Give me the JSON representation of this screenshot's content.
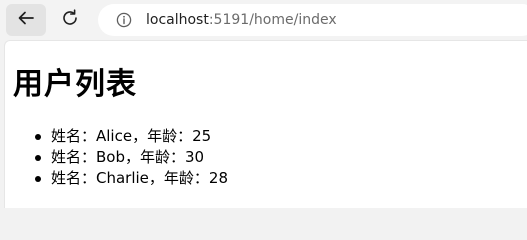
{
  "browser": {
    "url_host": "localhost",
    "url_path": ":5191/home/index"
  },
  "page": {
    "title": "用户列表",
    "users": [
      {
        "text": "姓名：Alice，年龄：25"
      },
      {
        "text": "姓名：Bob，年龄：30"
      },
      {
        "text": "姓名：Charlie，年龄：28"
      }
    ]
  },
  "icons": {
    "back": "arrow-left-icon",
    "reload": "reload-icon",
    "info": "info-icon"
  },
  "colors": {
    "toolbar_bg": "#f3f3f3",
    "page_bg": "#ffffff",
    "text": "#000000",
    "url_muted": "#6b6b6b"
  }
}
